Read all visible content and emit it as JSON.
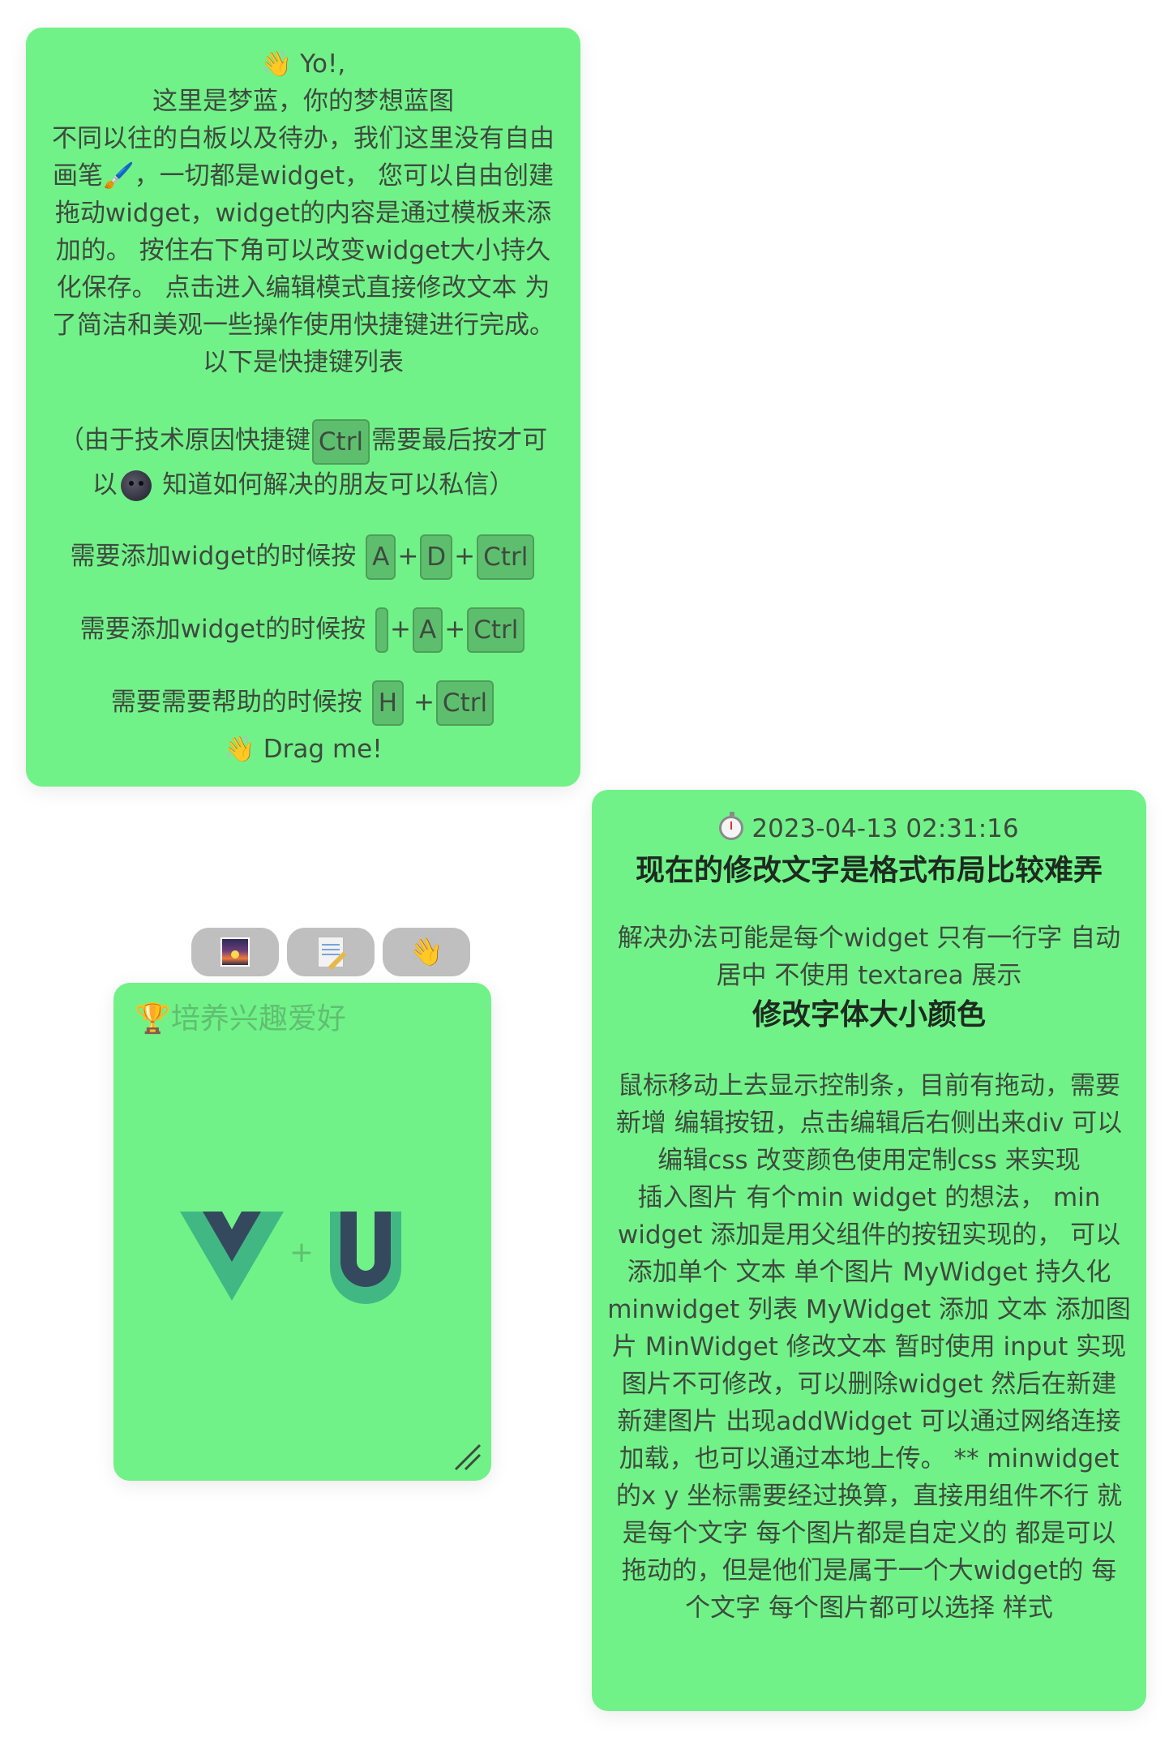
{
  "intro_card": {
    "greeting": "👋 Yo!,",
    "lines": [
      "这里是梦蓝，你的梦想蓝图",
      "不同以往的白板以及待办，我们这里没有自由",
      "画笔🖌️，一切都是widget， 您可以自由创建",
      "拖动widget，widget的内容是通过模板来添",
      "加的。 按住右下角可以改变widget大小持久",
      "化保存。 点击进入编辑模式直接修改文本 为",
      "了简洁和美观一些操作使用快捷键进行完成。",
      "以下是快捷键列表"
    ],
    "note_before_key": "（由于技术原因快捷键",
    "note_key": "Ctrl",
    "note_after_key": "需要最后按才可",
    "note_line2_prefix": "以",
    "note_line2_suffix": " 知道如何解决的朋友可以私信）",
    "shortcuts": [
      {
        "label": "需要添加widget的时候按",
        "keys": [
          "A",
          "D",
          "Ctrl"
        ]
      },
      {
        "label": "需要添加widget的时候按",
        "keys": [
          "",
          "A",
          "Ctrl"
        ]
      },
      {
        "label": "需要需要帮助的时候按",
        "keys": [
          "H",
          "Ctrl"
        ]
      }
    ],
    "plus": "+",
    "drag_text": "👋 Drag me!"
  },
  "toolbar": {
    "image_icon": "image-icon",
    "edit_icon": "memo-icon",
    "drag_icon": "👋"
  },
  "hobby_card": {
    "trophy": "🏆",
    "title": "培养兴趣爱好",
    "plus": "+"
  },
  "notes_card": {
    "timestamp": "2023-04-13 02:31:16",
    "heading1": "现在的修改文字是格式布局比较难弄",
    "para1": [
      "解决办法可能是每个widget 只有一行字 自动",
      "居中 不使用 textarea 展示"
    ],
    "heading2": "修改字体大小颜色",
    "para2": [
      "鼠标移动上去显示控制条，目前有拖动，需要",
      "新增 编辑按钮，点击编辑后右侧出来div 可以",
      "编辑css 改变颜色使用定制css 来实现",
      "插入图片 有个min widget 的想法， min",
      "widget 添加是用父组件的按钮实现的， 可以",
      "添加单个 文本 单个图片 MyWidget 持久化",
      "minwidget 列表 MyWidget 添加 文本 添加图",
      "片 MinWidget 修改文本 暂时使用 input 实现",
      "图片不可修改，可以删除widget 然后在新建",
      "新建图片 出现addWidget 可以通过网络连接",
      "加载，也可以通过本地上传。 ** minwidget",
      "的x y 坐标需要经过换算，直接用组件不行 就",
      "是每个文字 每个图片都是自定义的 都是可以",
      "拖动的，但是他们是属于一个大widget的 每",
      "个文字 每个图片都可以选择 样式"
    ]
  },
  "colors": {
    "card_bg": "#71f288",
    "key_bg": "#5dbf6d",
    "vue_dark": "#35495e",
    "vue_green": "#41b883"
  }
}
